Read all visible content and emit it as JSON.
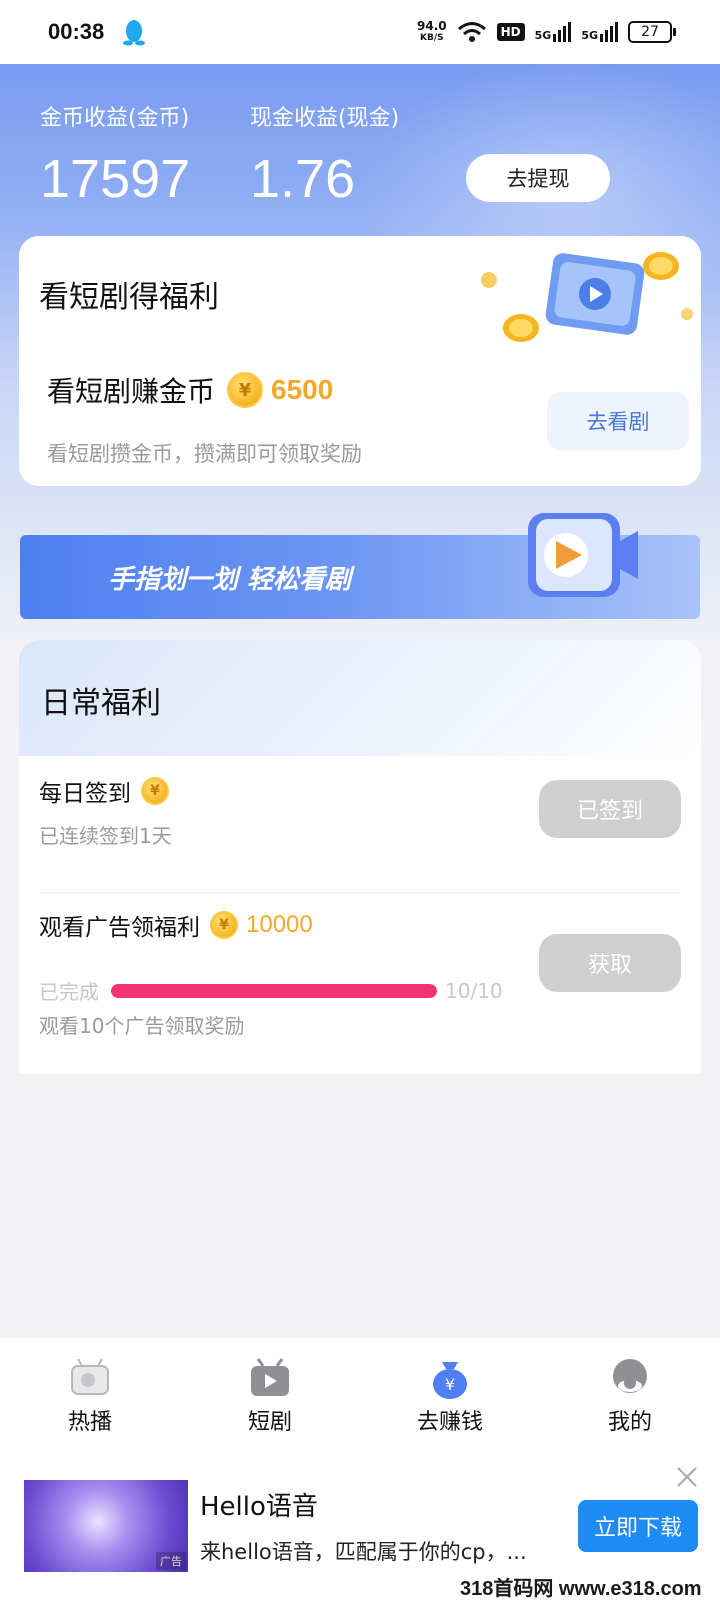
{
  "status_bar": {
    "time": "00:38",
    "net_speed_value": "94.0",
    "net_speed_unit": "KB/S",
    "hd_label": "HD",
    "signal_1": "5G",
    "signal_2": "5G",
    "battery": "27"
  },
  "earnings": {
    "coin_label": "金币收益(金币)",
    "coin_value": "17597",
    "cash_label": "现金收益(现金)",
    "cash_value": "1.76",
    "withdraw_label": "去提现"
  },
  "drama_card": {
    "title": "看短剧得福利",
    "sub_label": "看短剧赚金币",
    "coin_symbol": "¥",
    "amount": "6500",
    "description": "看短剧攒金币，攒满即可领取奖励",
    "button_label": "去看剧"
  },
  "banner": {
    "text": "手指划一划 轻松看剧"
  },
  "daily": {
    "title": "日常福利",
    "checkin": {
      "title": "每日签到",
      "description": "已连续签到1天",
      "button_label": "已签到"
    },
    "ads": {
      "title": "观看广告领福利",
      "amount": "10000",
      "progress_label": "已完成",
      "progress_text": "10/10",
      "progress_fraction": 1.0,
      "description": "观看10个广告领取奖励",
      "button_label": "获取"
    }
  },
  "tabs": [
    {
      "label": "热播",
      "icon": "tv-retro-icon"
    },
    {
      "label": "短剧",
      "icon": "tv-play-icon"
    },
    {
      "label": "去赚钱",
      "icon": "money-bag-icon"
    },
    {
      "label": "我的",
      "icon": "user-icon"
    }
  ],
  "ad": {
    "title": "Hello语音",
    "description": "来hello语音，匹配属于你的cp，...",
    "tag": "广告",
    "button_label": "立即下载"
  },
  "watermark": "318首码网 www.e318.com",
  "colors": {
    "accent_blue": "#4a78d8",
    "coin_gold": "#f0a92a",
    "progress_pink": "#f03372",
    "download_blue": "#1d8cf5"
  }
}
